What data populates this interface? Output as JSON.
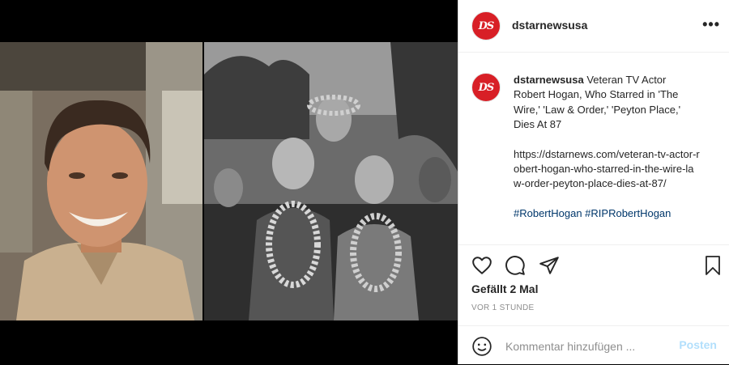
{
  "account": {
    "username": "dstarnewsusa",
    "avatar_text": "DS",
    "brand_color": "#d81f26"
  },
  "header": {
    "more_label": "•••"
  },
  "caption": {
    "username": "dstarnewsusa",
    "text": "Veteran TV Actor Robert Hogan, Who Starred in 'The Wire,' 'Law & Order,' 'Peyton Place,' Dies At 87",
    "link": "https://dstarnews.com/veteran-tv-actor-robert-hogan-who-starred-in-the-wire-law-order-peyton-place-dies-at-87/",
    "hashtags": "#RobertHogan #RIPRobertHogan"
  },
  "actions": {
    "likes": "Gefällt 2 Mal",
    "time": "VOR 1 STUNDE"
  },
  "comment": {
    "placeholder": "Kommentar hinzufügen ...",
    "post_label": "Posten"
  },
  "icons": [
    "heart-icon",
    "comment-icon",
    "share-icon",
    "bookmark-icon",
    "emoji-icon"
  ]
}
